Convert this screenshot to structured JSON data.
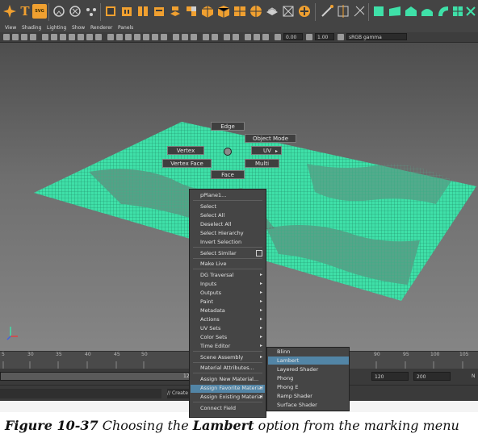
{
  "menubar": {
    "items": [
      "View",
      "Shading",
      "Lighting",
      "Show",
      "Renderer",
      "Panels"
    ]
  },
  "toolbar": {
    "field1": "0.00",
    "field2": "1.00",
    "colorspace": "sRGB gamma"
  },
  "shelf": {
    "text_icon": "T",
    "svg_icon": "SVG",
    "icons": [
      "select-tool-icon",
      "text-tool-icon",
      "svg-tool-icon",
      "lasso-icon",
      "paint-select-icon",
      "soft-mod-icon",
      "cube-icon",
      "sphere-icon",
      "cylinder-icon",
      "cone-icon",
      "plane-icon",
      "torus-icon",
      "combine-icon",
      "separate-icon",
      "bevel-icon",
      "extrude-icon",
      "bridge-icon",
      "append-icon",
      "merge-icon",
      "insert-loop-icon",
      "multicut-icon",
      "uv-editor-icon",
      "sculpt-icon"
    ]
  },
  "marking_menu": {
    "edge": "Edge",
    "object_mode": "Object Mode",
    "vertex": "Vertex",
    "uv": "UV",
    "uv_arrow": "▸",
    "vertex_face": "Vertex Face",
    "multi": "Multi",
    "face": "Face"
  },
  "context_menu": {
    "title": "pPlane1...",
    "items": [
      {
        "label": "Select",
        "arrow": ""
      },
      {
        "label": "Select All",
        "arrow": ""
      },
      {
        "label": "Deselect All",
        "arrow": ""
      },
      {
        "label": "Select Hierarchy",
        "arrow": ""
      },
      {
        "label": "Invert Selection",
        "arrow": ""
      },
      {
        "label": "Select Similar",
        "arrow": ""
      },
      {
        "label": "Make Live",
        "arrow": ""
      },
      {
        "label": "DG Traversal",
        "arrow": "▸"
      },
      {
        "label": "Inputs",
        "arrow": "▸"
      },
      {
        "label": "Outputs",
        "arrow": "▸"
      },
      {
        "label": "Paint",
        "arrow": "▸"
      },
      {
        "label": "Metadata",
        "arrow": "▸"
      },
      {
        "label": "Actions",
        "arrow": "▸"
      },
      {
        "label": "UV Sets",
        "arrow": "▸"
      },
      {
        "label": "Color Sets",
        "arrow": "▸"
      },
      {
        "label": "Time Editor",
        "arrow": "▸"
      },
      {
        "label": "Scene Assembly",
        "arrow": "▸"
      },
      {
        "label": "Material Attributes...",
        "arrow": ""
      },
      {
        "label": "Assign New Material...",
        "arrow": ""
      },
      {
        "label": "Assign Favorite Material",
        "arrow": "▸"
      },
      {
        "label": "Assign Existing Material",
        "arrow": "▸"
      },
      {
        "label": "Connect Field",
        "arrow": ""
      }
    ]
  },
  "submenu": {
    "items": [
      "Blinn",
      "Lambert",
      "Layered Shader",
      "Phong",
      "Phong E",
      "Ramp Shader",
      "Surface Shader"
    ],
    "selected": "Lambert"
  },
  "timeline": {
    "ticks": [
      "5",
      "30",
      "35",
      "40",
      "45",
      "50",
      "90",
      "95",
      "100",
      "105"
    ],
    "current_frame": "12",
    "end_frame": "120",
    "max_frame": "200",
    "end_label": "N"
  },
  "command_line": {
    "placeholder": "// Create"
  },
  "caption": {
    "prefix": "Figure 10-37",
    "middle": " Choosing the ",
    "bold": "Lambert",
    "suffix": " option from the marking menu"
  },
  "colors": {
    "accent": "#5285a6",
    "mesh": "#3fe0a8"
  }
}
